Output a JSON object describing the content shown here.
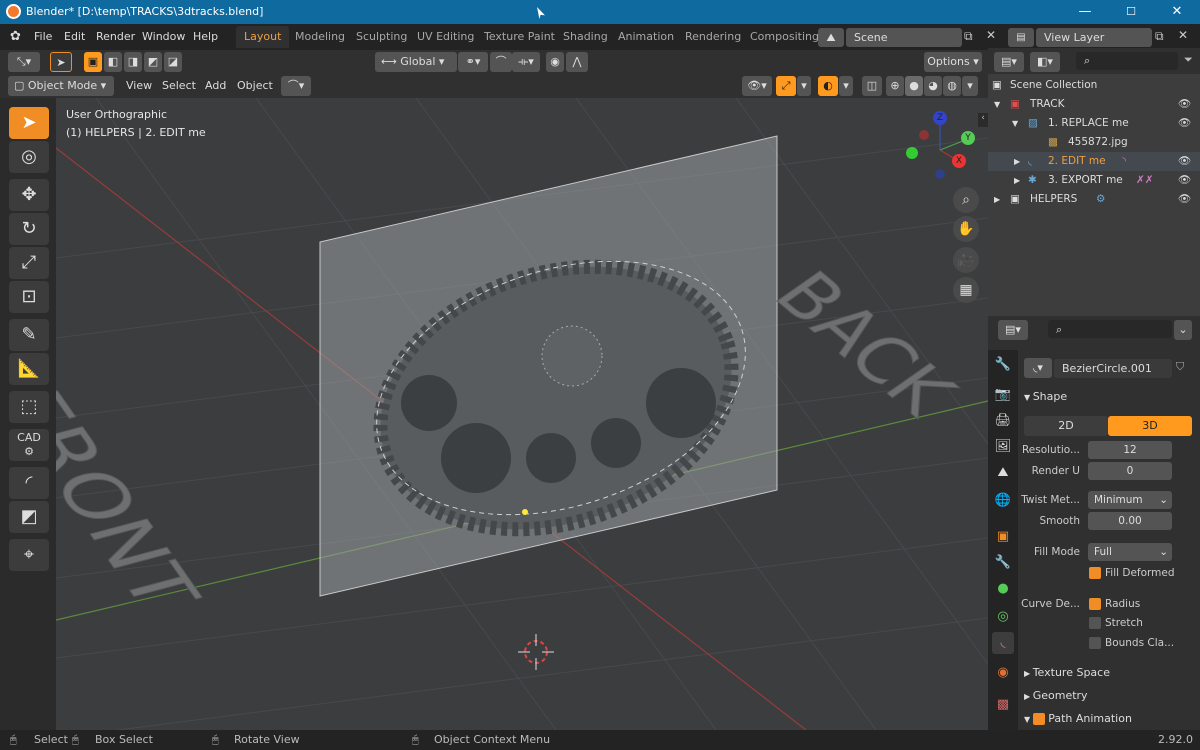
{
  "window": {
    "title": "Blender* [D:\\temp\\TRACKS\\3dtracks.blend]",
    "min": "—",
    "max": "☐",
    "close": "✕"
  },
  "menu": [
    "File",
    "Edit",
    "Render",
    "Window",
    "Help"
  ],
  "workspaces": [
    "Layout",
    "Modeling",
    "Sculpting",
    "UV Editing",
    "Texture Paint",
    "Shading",
    "Animation",
    "Rendering",
    "Compositing"
  ],
  "scene": "Scene",
  "view_layer": "View Layer",
  "viewport_header": {
    "transform": "Global",
    "options": "Options",
    "mode": "Object Mode",
    "menus": [
      "View",
      "Select",
      "Add",
      "Object"
    ]
  },
  "viewport": {
    "view_name": "User Orthographic",
    "collection_info": "(1) HELPERS | 2. EDIT me",
    "text_front": "FRONT",
    "text_back": "BACK"
  },
  "gizmo": {
    "x": "X",
    "y": "Y",
    "z": "Z"
  },
  "outliner": {
    "root": "Scene Collection",
    "rows": [
      {
        "label": "TRACK",
        "indent": 0,
        "color": "#ddd"
      },
      {
        "label": "1. REPLACE me",
        "indent": 1,
        "color": "#ddd"
      },
      {
        "label": "455872.jpg",
        "indent": 2,
        "color": "#ddd"
      },
      {
        "label": "2. EDIT me",
        "indent": 1,
        "color": "#f0a040"
      },
      {
        "label": "3. EXPORT me",
        "indent": 1,
        "color": "#ddd"
      },
      {
        "label": "HELPERS",
        "indent": 0,
        "color": "#ddd"
      }
    ]
  },
  "properties": {
    "object_name": "BezierCircle.001",
    "shape_panel": "Shape",
    "dim_2d": "2D",
    "dim_3d": "3D",
    "resolution_label": "Resolutio...",
    "resolution_value": "12",
    "render_u_label": "Render U",
    "render_u_value": "0",
    "twist_label": "Twist Met...",
    "twist_value": "Minimum",
    "smooth_label": "Smooth",
    "smooth_value": "0.00",
    "fill_mode_label": "Fill Mode",
    "fill_mode_value": "Full",
    "fill_deformed": "Fill Deformed",
    "curve_def_label": "Curve De...",
    "radius": "Radius",
    "stretch": "Stretch",
    "bounds": "Bounds Cla...",
    "texture_space": "Texture Space",
    "geometry": "Geometry",
    "path_animation": "Path Animation"
  },
  "status": {
    "select": "Select",
    "box_select": "Box Select",
    "rotate": "Rotate View",
    "context_menu": "Object Context Menu",
    "version": "2.92.0"
  }
}
